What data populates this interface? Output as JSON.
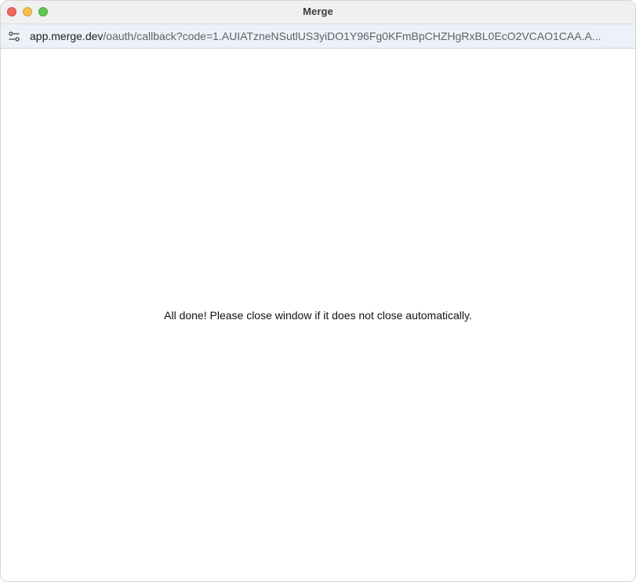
{
  "window": {
    "title": "Merge"
  },
  "addressbar": {
    "host": "app.merge.dev",
    "path": "/oauth/callback?code=1.AUIATzneNSutlUS3yiDO1Y96Fg0KFmBpCHZHgRxBL0EcO2VCAO1CAA.A..."
  },
  "page": {
    "message": "All done! Please close window if it does not close automatically."
  },
  "icons": {
    "site_settings": "site-settings-icon",
    "cursor": "mouse-pointer-icon"
  },
  "colors": {
    "close": "#ed6a5e",
    "minimize": "#f5bf4f",
    "zoom": "#61c554",
    "addressbar_bg": "#eef1f8"
  }
}
